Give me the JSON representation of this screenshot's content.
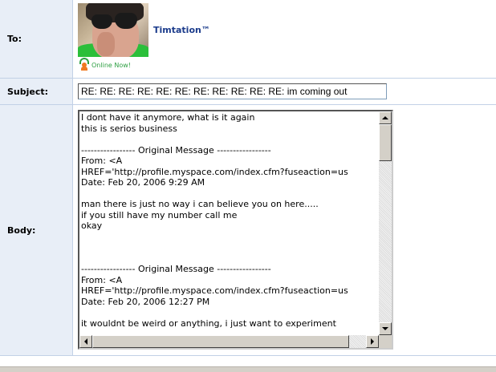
{
  "labels": {
    "to": "To:",
    "subject": "Subject:",
    "body": "Body:"
  },
  "recipient": {
    "name": "Timtation™",
    "status": "Online Now!",
    "avatar_icon": "profile-photo",
    "status_icon": "online-person-icon"
  },
  "subject": {
    "value": "RE: RE: RE: RE: RE: RE: RE: RE: RE: RE: RE: im coming out"
  },
  "body": {
    "text": "I dont have it anymore, what is it again\nthis is serios business\n\n----------------- Original Message -----------------\nFrom: <A\nHREF='http://profile.myspace.com/index.cfm?fuseaction=us\nDate: Feb 20, 2006 9:29 AM\n\nman there is just no way i can believe you on here.....\nif you still have my number call me\nokay\n\n\n\n----------------- Original Message -----------------\nFrom: <A\nHREF='http://profile.myspace.com/index.cfm?fuseaction=us\nDate: Feb 20, 2006 12:27 PM\n\nit wouldnt be weird or anything, i just want to experiment"
  },
  "colors": {
    "label_bg": "#e8eef7",
    "border": "#c2d1e6",
    "name_link": "#1c3c8c",
    "online_green": "#2ea043"
  }
}
